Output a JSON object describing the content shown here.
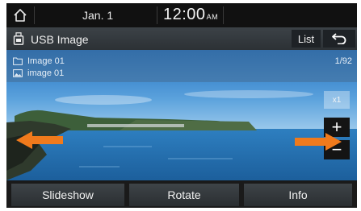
{
  "status": {
    "date": "Jan.  1",
    "time": "12:00",
    "ampm": "AM"
  },
  "title": {
    "text": "USB Image",
    "list_label": "List"
  },
  "file_info": {
    "folder": "Image 01",
    "file": "image 01",
    "counter": "1/92"
  },
  "zoom": {
    "level": "x1",
    "plus": "+",
    "minus": "−"
  },
  "bottom": {
    "slideshow": "Slideshow",
    "rotate": "Rotate",
    "info": "Info"
  },
  "icons": {
    "home": "home-icon",
    "usb": "usb-icon",
    "back": "back-icon",
    "folder": "folder-icon",
    "image": "image-icon",
    "prev": "left-arrow-icon",
    "next": "right-arrow-icon"
  },
  "colors": {
    "arrow": "#f07a1c",
    "overlay": "#466e96"
  }
}
